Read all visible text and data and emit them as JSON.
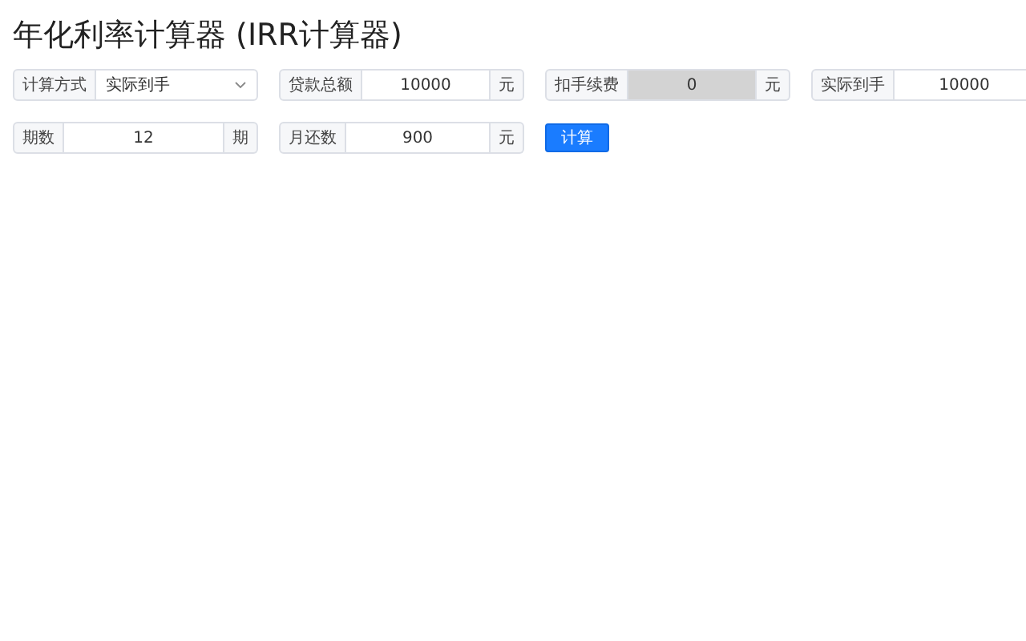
{
  "title": "年化利率计算器 (IRR计算器)",
  "rows": [
    {
      "fields": [
        {
          "kind": "select",
          "label": "计算方式",
          "value": "实际到手",
          "disabled": false
        },
        {
          "kind": "input",
          "label": "贷款总额",
          "value": "10000",
          "suffix": "元",
          "disabled": false
        },
        {
          "kind": "input",
          "label": "扣手续费",
          "value": "0",
          "suffix": "元",
          "disabled": true
        },
        {
          "kind": "input",
          "label": "实际到手",
          "value": "10000",
          "disabled": false
        }
      ]
    },
    {
      "fields": [
        {
          "kind": "input",
          "label": "期数",
          "value": "12",
          "suffix": "期",
          "disabled": false
        },
        {
          "kind": "input",
          "label": "月还数",
          "value": "900",
          "suffix": "元",
          "disabled": false
        }
      ],
      "button": "计算"
    }
  ]
}
